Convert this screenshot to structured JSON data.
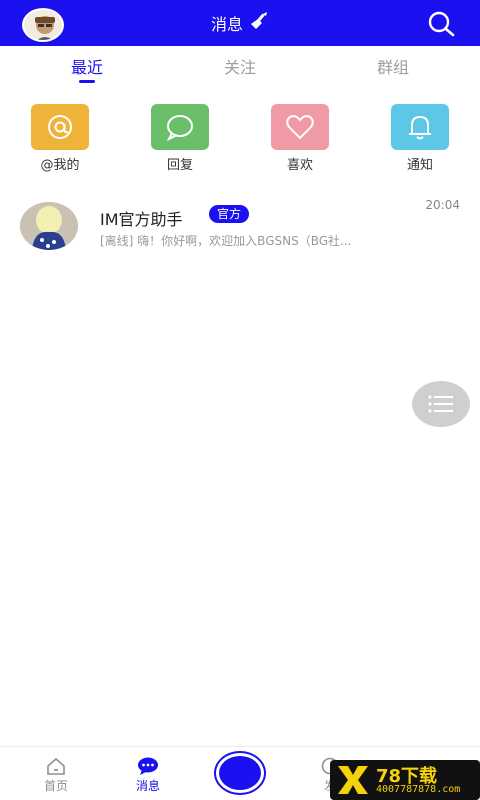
{
  "header": {
    "title": "消息",
    "title_icon": "broom-icon",
    "search_icon": "search-icon"
  },
  "tabs": [
    {
      "label": "最近",
      "active": true
    },
    {
      "label": "关注",
      "active": false
    },
    {
      "label": "群组",
      "active": false
    }
  ],
  "quick_actions": [
    {
      "label": "@我的",
      "icon": "at-icon",
      "color": "#f0b33a"
    },
    {
      "label": "回复",
      "icon": "chat-bubble-icon",
      "color": "#6bbf6b"
    },
    {
      "label": "喜欢",
      "icon": "heart-icon",
      "color": "#ef9aa4"
    },
    {
      "label": "通知",
      "icon": "bell-icon",
      "color": "#5cc7e6"
    }
  ],
  "conversations": [
    {
      "name": "IM官方助手",
      "badge": "官方",
      "time": "20:04",
      "message": "[离线] 嗨！你好啊，欢迎加入BGSNS（BG社..."
    }
  ],
  "bottom_nav": [
    {
      "label": "首页",
      "icon": "home-icon",
      "active": false
    },
    {
      "label": "消息",
      "icon": "message-icon",
      "active": true
    },
    {
      "label": "发",
      "icon": "discover-icon",
      "active": false
    }
  ],
  "watermark": {
    "brand": "78下载",
    "phone": "4007787878.com"
  },
  "colors": {
    "primary": "#1a10f0",
    "fab": "#cfcfcf"
  }
}
